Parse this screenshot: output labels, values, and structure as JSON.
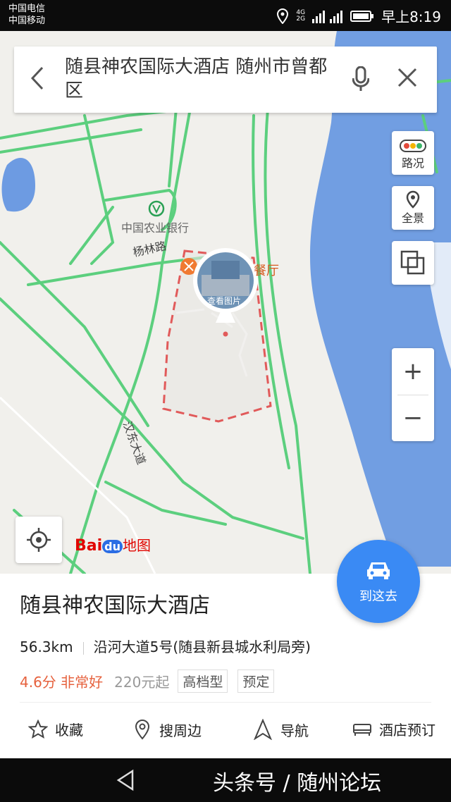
{
  "status_bar": {
    "carrier1": "中国电信",
    "carrier2": "中国移动",
    "time": "早上8:19",
    "network1": "4G",
    "network2": "2G"
  },
  "search": {
    "query": "随县神农国际大酒店 随州市曾都区"
  },
  "map": {
    "bank_label": "中国农业银行",
    "road1": "杨林路",
    "road2": "汉东大道",
    "restaurant_label": "餐厅",
    "photo_label": "查看图片",
    "logo_bai": "Bai",
    "logo_du": "du",
    "logo_ditu": "地图",
    "traffic_label": "路况",
    "panorama_label": "全景",
    "zoom_in": "+",
    "zoom_out": "−"
  },
  "place": {
    "name": "随县神农国际大酒店",
    "distance": "56.3km",
    "address": "沿河大道5号(随县新县城水利局旁)",
    "rating": "4.6分 非常好",
    "price": "220元起",
    "tags": [
      "高档型",
      "预定"
    ],
    "go_label": "到这去"
  },
  "actions": {
    "favorite": "收藏",
    "nearby": "搜周边",
    "navigate": "导航",
    "hotel_booking": "酒店预订"
  },
  "watermark": "头条号 / 随州论坛",
  "colors": {
    "accent": "#3a8af4",
    "rating": "#e6613d",
    "road": "#5ccf7e",
    "river": "#5b8fe0",
    "boundary": "#e15a5a"
  }
}
